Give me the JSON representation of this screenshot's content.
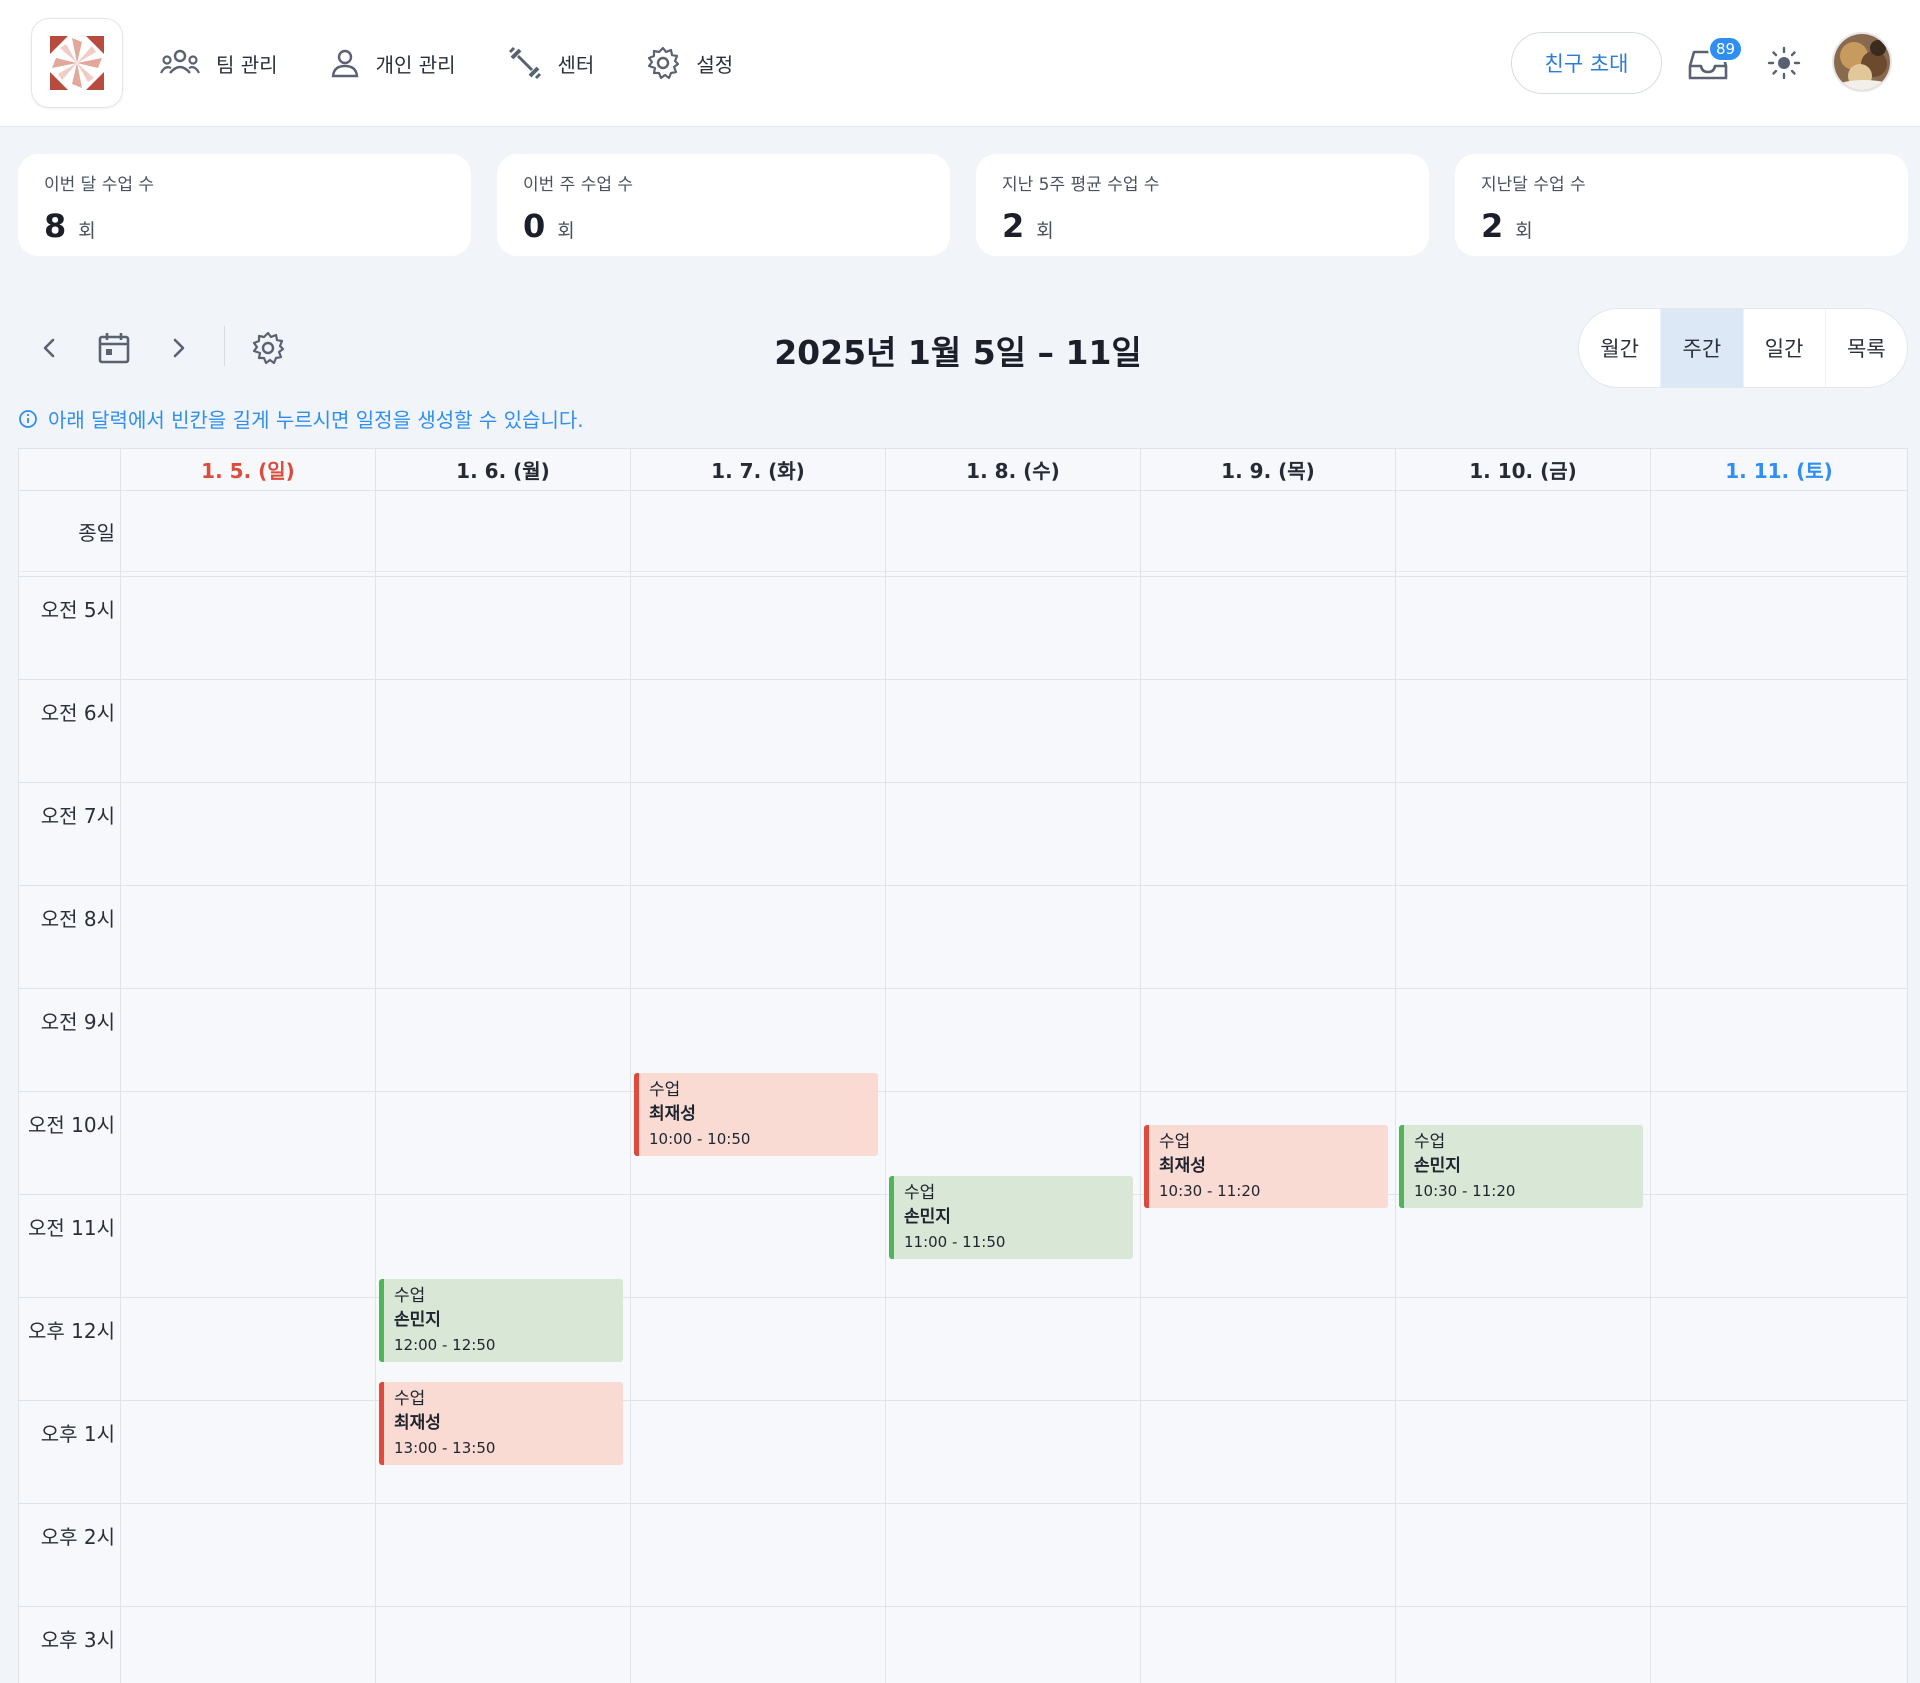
{
  "header": {
    "nav": [
      {
        "label": "팀 관리",
        "icon": "team-icon"
      },
      {
        "label": "개인 관리",
        "icon": "person-icon"
      },
      {
        "label": "센터",
        "icon": "dumbbell-icon"
      },
      {
        "label": "설정",
        "icon": "gear-icon"
      }
    ],
    "invite_label": "친구 초대",
    "inbox_badge": "89"
  },
  "stats": [
    {
      "label": "이번 달 수업 수",
      "value": "8",
      "unit": "회"
    },
    {
      "label": "이번 주 수업 수",
      "value": "0",
      "unit": "회"
    },
    {
      "label": "지난 5주 평균 수업 수",
      "value": "2",
      "unit": "회"
    },
    {
      "label": "지난달 수업 수",
      "value": "2",
      "unit": "회"
    }
  ],
  "calendar": {
    "range_title": "2025년 1월 5일 – 11일",
    "views": [
      "월간",
      "주간",
      "일간",
      "목록"
    ],
    "active_view": "주간",
    "hint": "아래 달력에서 빈칸을 길게 누르시면 일정을 생성할 수 있습니다.",
    "allday_label": "종일",
    "days": [
      "1. 5. (일)",
      "1. 6. (월)",
      "1. 7. (화)",
      "1. 8. (수)",
      "1. 9. (목)",
      "1. 10. (금)",
      "1. 11. (토)"
    ],
    "hours": [
      "오전 5시",
      "오전 6시",
      "오전 7시",
      "오전 8시",
      "오전 9시",
      "오전 10시",
      "오전 11시",
      "오후 12시",
      "오후 1시",
      "오후 2시",
      "오후 3시"
    ],
    "events": [
      {
        "day": 2,
        "title": "수업",
        "name": "최재성",
        "time": "10:00 - 10:50",
        "color": "red"
      },
      {
        "day": 3,
        "title": "수업",
        "name": "손민지",
        "time": "11:00 - 11:50",
        "color": "green"
      },
      {
        "day": 4,
        "title": "수업",
        "name": "최재성",
        "time": "10:30 - 11:20",
        "color": "red"
      },
      {
        "day": 5,
        "title": "수업",
        "name": "손민지",
        "time": "10:30 - 11:20",
        "color": "green"
      },
      {
        "day": 1,
        "title": "수업",
        "name": "손민지",
        "time": "12:00 - 12:50",
        "color": "green"
      },
      {
        "day": 1,
        "title": "수업",
        "name": "최재성",
        "time": "13:00 - 13:50",
        "color": "red"
      }
    ]
  },
  "colors": {
    "accent": "#2f8ef4",
    "sunday": "#de4b3b",
    "saturday": "#2f8ef4",
    "event_red_bg": "#f9dbd3",
    "event_red_bar": "#e04a3c",
    "event_green_bg": "#d9e7d6",
    "event_green_bar": "#4fb55a"
  }
}
